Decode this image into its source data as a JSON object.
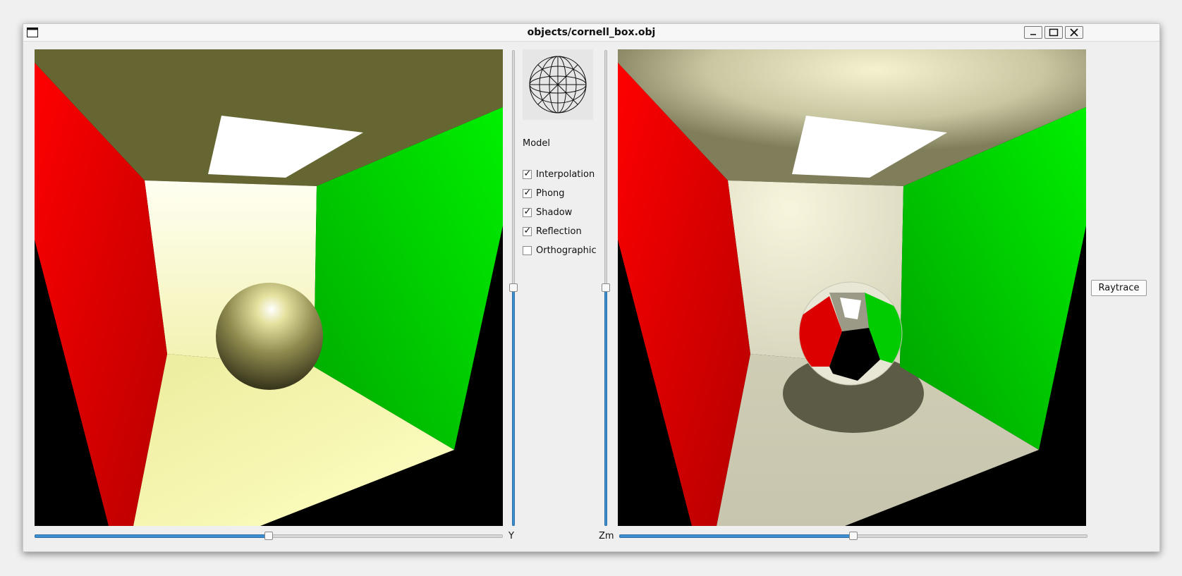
{
  "window": {
    "title": "objects/cornell_box.obj",
    "controls": [
      "minimize",
      "maximize",
      "close"
    ]
  },
  "left_view": {
    "icon": "opengl-render"
  },
  "right_view": {
    "icon": "raytrace-render"
  },
  "sliders": {
    "y": {
      "label": "Y",
      "value_fraction": 0.5
    },
    "zm": {
      "label": "Zm",
      "value_fraction": 0.5
    },
    "left_vertical": {
      "value_fraction": 0.5
    },
    "right_vertical": {
      "value_fraction": 0.5
    }
  },
  "panel": {
    "model_label": "Model",
    "options": [
      {
        "label": "Interpolation",
        "checked": true
      },
      {
        "label": "Phong",
        "checked": true
      },
      {
        "label": "Shadow",
        "checked": true
      },
      {
        "label": "Reflection",
        "checked": true
      },
      {
        "label": "Orthographic",
        "checked": false
      }
    ]
  },
  "buttons": {
    "raytrace": "Raytrace"
  },
  "colors": {
    "red_wall": "#ff0000",
    "green_wall": "#00ee00",
    "slider_fill": "#3d8fd2"
  }
}
